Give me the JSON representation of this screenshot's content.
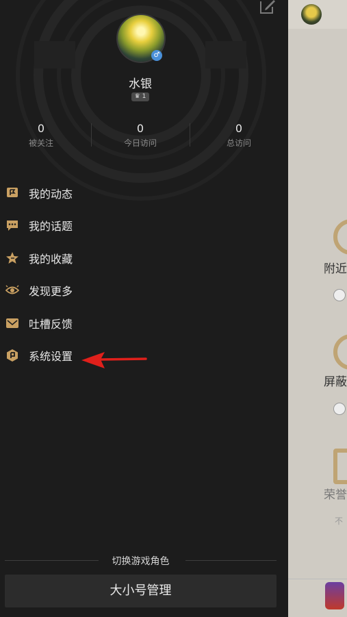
{
  "profile": {
    "username": "水银",
    "level": "1",
    "gender_symbol": "♂"
  },
  "stats": [
    {
      "value": "0",
      "label": "被关注"
    },
    {
      "value": "0",
      "label": "今日访问"
    },
    {
      "value": "0",
      "label": "总访问"
    }
  ],
  "menu": [
    {
      "label": "我的动态",
      "icon": "flag-icon"
    },
    {
      "label": "我的话题",
      "icon": "chat-bubble-icon"
    },
    {
      "label": "我的收藏",
      "icon": "star-icon"
    },
    {
      "label": "发现更多",
      "icon": "eye-icon"
    },
    {
      "label": "吐槽反馈",
      "icon": "mail-icon"
    },
    {
      "label": "系统设置",
      "icon": "settings-hex-icon"
    }
  ],
  "footer": {
    "switch_label": "切换游戏角色",
    "account_button": "大小号管理"
  },
  "background_app": {
    "label_1": "附近",
    "label_2": "屏蔽",
    "label_3": "荣誉",
    "label_4": "不"
  },
  "colors": {
    "drawer_bg": "#1c1c1c",
    "icon_gold": "#c9a062",
    "annotation_arrow": "#e0201b"
  }
}
